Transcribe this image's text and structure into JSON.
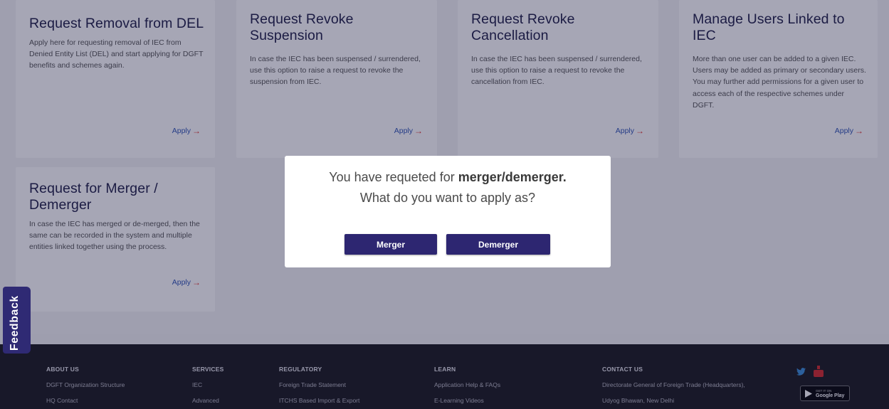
{
  "cards": [
    {
      "title": "Request Removal from DEL",
      "description": "Apply here for requesting removal of IEC from Denied Entity List (DEL) and start applying for DGFT benefits and schemes again.",
      "apply_label": "Apply"
    },
    {
      "title": "Request Revoke Suspension",
      "description": "In case the IEC has been suspensed / surrendered, use this option to raise a request to revoke the suspension from IEC.",
      "apply_label": "Apply"
    },
    {
      "title": "Request Revoke Cancellation",
      "description": "In case the IEC has been suspensed / surrendered, use this option to raise a request to revoke the cancellation from IEC.",
      "apply_label": "Apply"
    },
    {
      "title": "Manage Users Linked to IEC",
      "description": "More than one user can be added to a given IEC. Users may be added as primary or secondary users. You may further add permissions for a given user to access each of the respective schemes under DGFT.",
      "apply_label": "Apply"
    },
    {
      "title": "Request for Merger / Demerger",
      "description": "In case the IEC has merged or de-merged, then the same can be recorded in the system and multiple entities linked together using the process.",
      "apply_label": "Apply"
    }
  ],
  "modal": {
    "line1_prefix": "You have requeted for ",
    "line1_bold": "merger/demerger.",
    "line2": "What do you want to apply as?",
    "merger_label": "Merger",
    "demerger_label": "Demerger"
  },
  "feedback_label": "Feedback",
  "footer": {
    "columns": [
      {
        "heading": "ABOUT US",
        "links": [
          "DGFT Organization Structure",
          "HQ Contact"
        ]
      },
      {
        "heading": "SERVICES",
        "links": [
          "IEC",
          "Advanced"
        ]
      },
      {
        "heading": "REGULATORY",
        "links": [
          "Foreign Trade Statement",
          "ITCHS Based Import & Export"
        ]
      },
      {
        "heading": "LEARN",
        "links": [
          "Application Help & FAQs",
          "E-Learning Videos"
        ]
      },
      {
        "heading": "CONTACT US",
        "links": [
          "Directorate General of Foreign Trade (Headquarters),",
          "Udyog Bhawan, New Delhi"
        ]
      }
    ],
    "google_play": {
      "small": "GET IT ON",
      "big": "Google Play"
    },
    "icons": [
      "twitter-icon",
      "youtube-icon",
      "google-play-icon"
    ]
  },
  "colors": {
    "accent": "#2d2671",
    "apply_link": "#2f55b5",
    "arrow": "#e0322d",
    "footer_bg": "#1b1b1d"
  }
}
